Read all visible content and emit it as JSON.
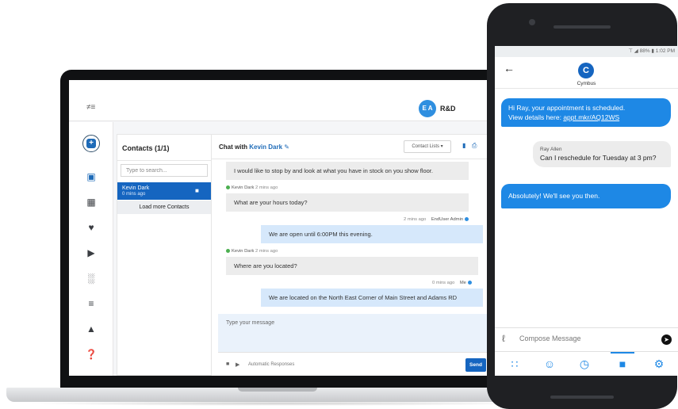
{
  "laptop": {
    "topbar": {
      "avatar_initials": "E A",
      "org_name": "R&D"
    },
    "contacts": {
      "title": "Contacts (1/1)",
      "search_placeholder": "Type to search...",
      "items": [
        {
          "name": "Kevin Dark",
          "time": "0 mins ago"
        }
      ],
      "load_more": "Load more Contacts"
    },
    "chat": {
      "title_prefix": "Chat with",
      "contact_name": "Kevin Dark",
      "contact_lists_label": "Contact Lists ▾",
      "messages": [
        {
          "direction": "in",
          "text": "I would like to stop by and look at what you have in stock on you show floor."
        },
        {
          "direction": "in",
          "sender": "Kevin Dark",
          "time": "2 mins ago",
          "text": "What are your hours today?"
        },
        {
          "direction": "out",
          "sender": "EndUser Admin",
          "time": "2 mins ago",
          "text": "We are open until 6:00PM this evening."
        },
        {
          "direction": "in",
          "sender": "Kevin Dark",
          "time": "2 mins ago",
          "text": "Where are you located?"
        },
        {
          "direction": "out",
          "sender": "Me",
          "time": "0 mins ago",
          "text": "We are located on the North East Corner of Main Street and Adams RD"
        }
      ],
      "compose_placeholder": "Type your message",
      "automatic_responses": "Automatic Responses",
      "send_label": "Send"
    }
  },
  "phone": {
    "status_bar": "⊤ ◢ 88% ▮ 1:02 PM",
    "brand_name": "Cymbus",
    "brand_initial": "C",
    "messages": [
      {
        "direction": "out",
        "line1": "Hi Ray, your appointment is scheduled.",
        "line2_prefix": "View details here: ",
        "link": "appt.mkr/AQ12WS"
      },
      {
        "direction": "in",
        "sender": "Ray Allen",
        "text": "Can I reschedule for Tuesday at 3 pm?"
      },
      {
        "direction": "out",
        "text": "Absolutely! We'll see you then."
      }
    ],
    "compose_placeholder": "Compose Message"
  },
  "colors": {
    "accent": "#1565c0",
    "bubble_out_laptop": "#d6e8fb",
    "bubble_out_phone": "#1e88e5",
    "bubble_in": "#ececec",
    "online": "#4caf50"
  }
}
